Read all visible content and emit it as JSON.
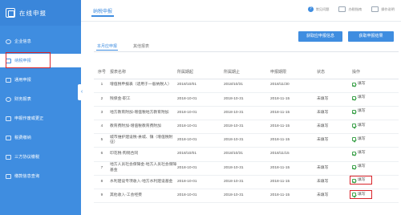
{
  "app": {
    "title": "在线申报"
  },
  "sidebar": {
    "items": [
      {
        "label": "企业信息"
      },
      {
        "label": "纳税申报"
      },
      {
        "label": "通用申报"
      },
      {
        "label": "财务报表"
      },
      {
        "label": "申报作废或更正"
      },
      {
        "label": "税费缴纳"
      },
      {
        "label": "三方协议缴税"
      },
      {
        "label": "缴款信息查询"
      }
    ],
    "active_index": 1
  },
  "header": {
    "title": "纳税申报",
    "tools": [
      {
        "label": "常见问题",
        "icon": "help-icon"
      },
      {
        "label": "办税指南",
        "icon": "guide-icon"
      },
      {
        "label": "操作说明",
        "icon": "manual-icon"
      }
    ]
  },
  "actions": {
    "fetch_button": "获取应申报信息",
    "result_button": "获取申报结果"
  },
  "tabs": [
    {
      "label": "本月应申报",
      "active": true
    },
    {
      "label": "其他报表",
      "active": false
    }
  ],
  "table": {
    "columns": [
      "序号",
      "报表名称",
      "所属期起",
      "所属期止",
      "申报期限",
      "状态",
      "操作"
    ],
    "rows": [
      {
        "no": "1",
        "name": "增值税申报表（适用于一般纳税人）",
        "start": "2018/10/01",
        "end": "2018/10/31",
        "deadline": "2018/11/30",
        "status": "",
        "action": "填写"
      },
      {
        "no": "2",
        "name": "残保金-职工",
        "start": "2018-10-01",
        "end": "2018-10-31",
        "deadline": "2018-11-15",
        "status": "未填写",
        "action": "填写"
      },
      {
        "no": "3",
        "name": "地方教育附加-增值税地方教育附加",
        "start": "2018-10-01",
        "end": "2018-10-31",
        "deadline": "2018-11-15",
        "status": "未填写",
        "action": "填写"
      },
      {
        "no": "4",
        "name": "教育费附加-增值税教育费附加",
        "start": "2018-10-01",
        "end": "2018-10-31",
        "deadline": "2018-11-15",
        "status": "未填写",
        "action": "填写"
      },
      {
        "no": "5",
        "name": "城市维护建设税-县城、镇（增值税附征）",
        "start": "2018-10-01",
        "end": "2018-10-31",
        "deadline": "2018-11-15",
        "status": "未填写",
        "action": "填写"
      },
      {
        "no": "6",
        "name": "印花税-购销合同",
        "start": "2018/10/01",
        "end": "2018/10/31",
        "deadline": "2018/11/15",
        "status": "",
        "action": "填写"
      },
      {
        "no": "7",
        "name": "地方人员社会保障金-地方人员社会保障基金",
        "start": "2018-10-01",
        "end": "2018-10-31",
        "deadline": "2018-11-15",
        "status": "未填写",
        "action": "填写"
      },
      {
        "no": "8",
        "name": "水利建设专项收入-地方水利建设基金",
        "start": "2018-10-01",
        "end": "2018-10-31",
        "deadline": "2018-11-15",
        "status": "未填写",
        "action": "填写"
      },
      {
        "no": "9",
        "name": "其他收入-工会经费",
        "start": "2018-10-01",
        "end": "2018-10-31",
        "deadline": "2018-11-15",
        "status": "未填写",
        "action": "填写"
      }
    ]
  },
  "colors": {
    "primary": "#3f8de0",
    "highlight": "#d9252b",
    "check": "#3fa34d"
  }
}
